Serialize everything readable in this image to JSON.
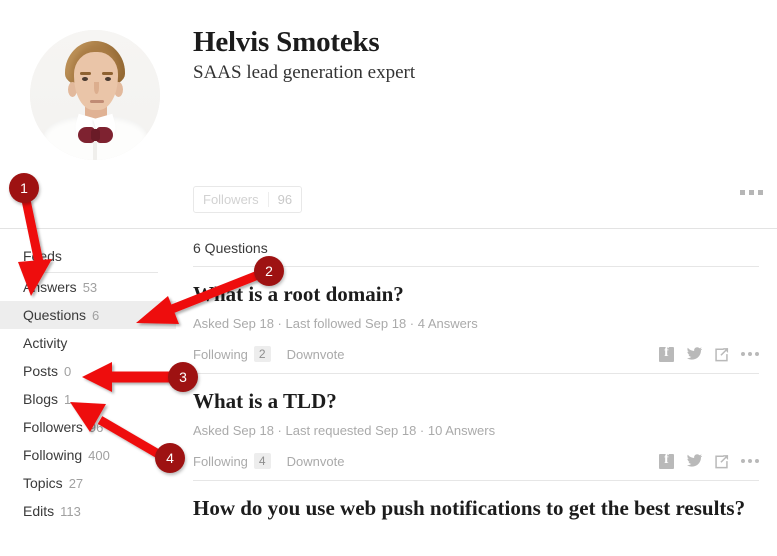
{
  "profile": {
    "name": "Helvis Smoteks",
    "tagline": "SAAS lead generation expert",
    "avatar_icon": "user-avatar-photo",
    "followers_label": "Followers",
    "followers_count": "96",
    "more_icon": "ellipsis-icon"
  },
  "sidebar": {
    "title": "Feeds",
    "items": [
      {
        "label": "Answers",
        "count": "53",
        "active": false
      },
      {
        "label": "Questions",
        "count": "6",
        "active": true
      },
      {
        "label": "Activity",
        "count": "",
        "active": false
      },
      {
        "label": "Posts",
        "count": "0",
        "active": false
      },
      {
        "label": "Blogs",
        "count": "1",
        "active": false
      },
      {
        "label": "Followers",
        "count": "96",
        "active": false
      },
      {
        "label": "Following",
        "count": "400",
        "active": false
      },
      {
        "label": "Topics",
        "count": "27",
        "active": false
      },
      {
        "label": "Edits",
        "count": "113",
        "active": false
      }
    ]
  },
  "feed": {
    "heading": "6 Questions",
    "questions": [
      {
        "title": "What is a root domain?",
        "meta": "Asked Sep 18 · Last followed Sep 18 · 4 Answers",
        "following_label": "Following",
        "following_count": "2",
        "downvote_label": "Downvote",
        "share": {
          "facebook_icon": "facebook-icon",
          "twitter_icon": "twitter-icon",
          "share_icon": "share-icon",
          "more_icon": "ellipsis-icon"
        }
      },
      {
        "title": "What is a TLD?",
        "meta": "Asked Sep 18 · Last requested Sep 18 · 10 Answers",
        "following_label": "Following",
        "following_count": "4",
        "downvote_label": "Downvote",
        "share": {
          "facebook_icon": "facebook-icon",
          "twitter_icon": "twitter-icon",
          "share_icon": "share-icon",
          "more_icon": "ellipsis-icon"
        }
      },
      {
        "title": "How do you use web push notifications to get the best results?",
        "meta": "",
        "following_label": "",
        "following_count": "",
        "downvote_label": "",
        "share": {}
      }
    ]
  },
  "annotations": {
    "marker_color": "#9e1212",
    "arrow_color": "#ee1111",
    "markers": [
      {
        "id": "1",
        "label": "1"
      },
      {
        "id": "2",
        "label": "2"
      },
      {
        "id": "3",
        "label": "3"
      },
      {
        "id": "4",
        "label": "4"
      }
    ]
  }
}
